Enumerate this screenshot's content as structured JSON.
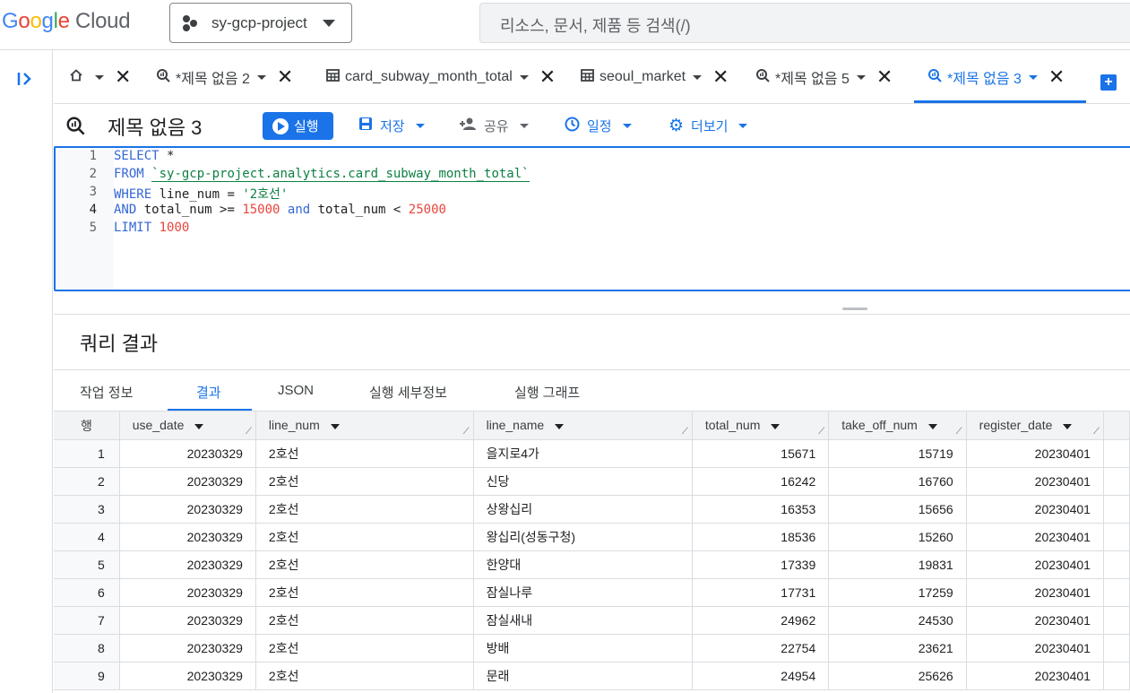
{
  "header": {
    "logo_google": "Google",
    "logo_cloud": "Cloud",
    "project": "sy-gcp-project",
    "search_placeholder": "리소스, 문서, 제품 등 검색(/)"
  },
  "tabs": [
    {
      "label": "",
      "icon": "home-icon"
    },
    {
      "label": "*제목 없음 2",
      "icon": "query-icon"
    },
    {
      "label": "card_subway_month_total",
      "icon": "table-icon"
    },
    {
      "label": "seoul_market",
      "icon": "table-icon"
    },
    {
      "label": "*제목 없음 5",
      "icon": "query-icon"
    },
    {
      "label": "*제목 없음 3",
      "icon": "query-icon",
      "active": true
    }
  ],
  "toolbar": {
    "title": "제목 없음 3",
    "run": "실행",
    "save": "저장",
    "share": "공유",
    "schedule": "일정",
    "more": "더보기"
  },
  "editor": {
    "line_numbers": [
      "1",
      "2",
      "3",
      "4",
      "5"
    ],
    "select": "SELECT",
    "star": " *",
    "from": "FROM",
    "table_ref": "`sy-gcp-project.analytics.card_subway_month_total`",
    "where": "WHERE",
    "where_cond": " line_num = ",
    "where_val": "'2호선'",
    "and1": "AND",
    "cond2a": " total_num >= ",
    "val1": "15000",
    "and2": "and",
    "cond2b": " total_num < ",
    "val2": "25000",
    "limit": "LIMIT",
    "limit_val": "1000"
  },
  "results": {
    "title": "쿼리 결과",
    "tabs": [
      "작업 정보",
      "결과",
      "JSON",
      "실행 세부정보",
      "실행 그래프"
    ],
    "active_tab": "결과",
    "row_header": "행",
    "columns": [
      "use_date",
      "line_num",
      "line_name",
      "total_num",
      "take_off_num",
      "register_date"
    ],
    "rows": [
      [
        "1",
        "20230329",
        "2호선",
        "을지로4가",
        "15671",
        "15719",
        "20230401"
      ],
      [
        "2",
        "20230329",
        "2호선",
        "신당",
        "16242",
        "16760",
        "20230401"
      ],
      [
        "3",
        "20230329",
        "2호선",
        "상왕십리",
        "16353",
        "15656",
        "20230401"
      ],
      [
        "4",
        "20230329",
        "2호선",
        "왕십리(성동구청)",
        "18536",
        "15260",
        "20230401"
      ],
      [
        "5",
        "20230329",
        "2호선",
        "한양대",
        "17339",
        "19831",
        "20230401"
      ],
      [
        "6",
        "20230329",
        "2호선",
        "잠실나루",
        "17731",
        "17259",
        "20230401"
      ],
      [
        "7",
        "20230329",
        "2호선",
        "잠실새내",
        "24962",
        "24530",
        "20230401"
      ],
      [
        "8",
        "20230329",
        "2호선",
        "방배",
        "22754",
        "23621",
        "20230401"
      ],
      [
        "9",
        "20230329",
        "2호선",
        "문래",
        "24954",
        "25626",
        "20230401"
      ]
    ]
  },
  "colors": {
    "accent": "#1a73e8",
    "string": "#0d8043",
    "number": "#e8453c",
    "keyword": "#3367d6"
  }
}
